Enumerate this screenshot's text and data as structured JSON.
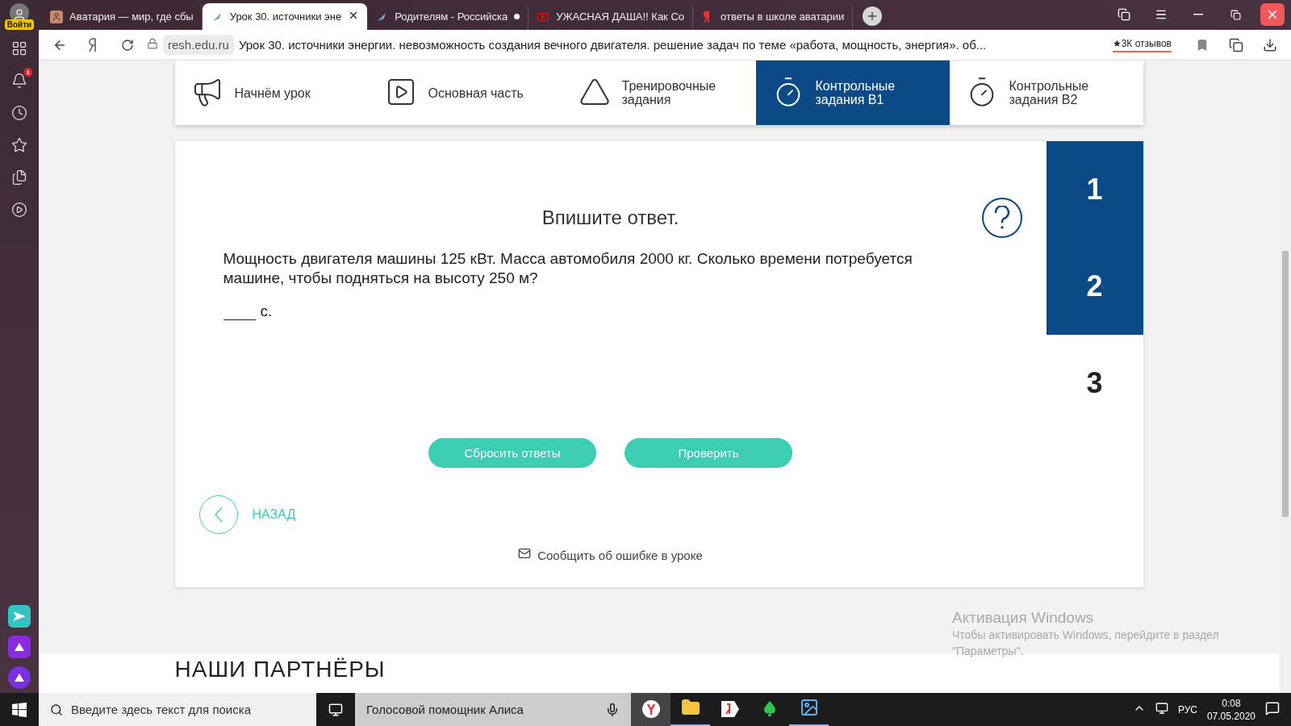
{
  "browser": {
    "login_label": "Войти",
    "notification_count": "1",
    "tabs": [
      {
        "title": "Аватария — мир, где сбы",
        "kind": "face",
        "selected": false,
        "dot": false
      },
      {
        "title": "Урок 30. источники эне",
        "kind": "resh",
        "selected": true,
        "dot": false
      },
      {
        "title": "Родителям - Российска",
        "kind": "resh",
        "selected": false,
        "dot": true
      },
      {
        "title": "УЖАСНАЯ ДАША!! Как Со",
        "kind": "video",
        "selected": false,
        "dot": false
      },
      {
        "title": "ответы в школе аватарии",
        "kind": "yandex",
        "selected": false,
        "dot": false
      }
    ],
    "address": {
      "domain": "resh.edu.ru",
      "page_title": "Урок 30. источники энергии. невозможность создания вечного двигателя. решение задач по теме «работа, мощность, энергия». об...",
      "reviews": "★3К отзывов"
    }
  },
  "lesson_nav": [
    {
      "label": "Начнём урок",
      "kind": "start",
      "selected": false
    },
    {
      "label": "Основная часть",
      "kind": "main",
      "selected": false
    },
    {
      "label": "Тренировочные задания",
      "kind": "training",
      "selected": false
    },
    {
      "label": "Контрольные задания В1",
      "kind": "timer",
      "selected": true
    },
    {
      "label": "Контрольные задания В2",
      "kind": "timer",
      "selected": false
    }
  ],
  "task": {
    "instruction": "Впишите ответ.",
    "question": "Мощность двигателя машины 125 кВт. Масса автомобиля 2000 кг. Сколько времени потребуется машине, чтобы подняться на высоту 250 м?",
    "unit": "с."
  },
  "task_numbers": [
    {
      "label": "1",
      "highlighted": true
    },
    {
      "label": "2",
      "highlighted": true
    },
    {
      "label": "3",
      "highlighted": false
    }
  ],
  "buttons": [
    "Сбросить ответы",
    "Проверить"
  ],
  "back_label": "НАЗАД",
  "report_link": "Сообщить об ошибке в уроке",
  "partners_heading": "НАШИ ПАРТНЁРЫ",
  "activation": {
    "title": "Активация Windows",
    "text": "Чтобы активировать Windows, перейдите в раздел \"Параметры\"."
  },
  "taskbar": {
    "search_placeholder": "Введите здесь текст для поиска",
    "assistant": "Голосовой помощник Алиса",
    "apps": [
      {
        "kind": "browser",
        "active": true,
        "running": false
      },
      {
        "kind": "folder",
        "active": false,
        "running": true
      },
      {
        "kind": "yandex",
        "active": false,
        "running": false
      },
      {
        "kind": "cards",
        "active": false,
        "running": false
      },
      {
        "kind": "photos",
        "active": false,
        "running": true
      }
    ],
    "language": "РУС",
    "time": "0:08",
    "date": "07.05.2020"
  }
}
